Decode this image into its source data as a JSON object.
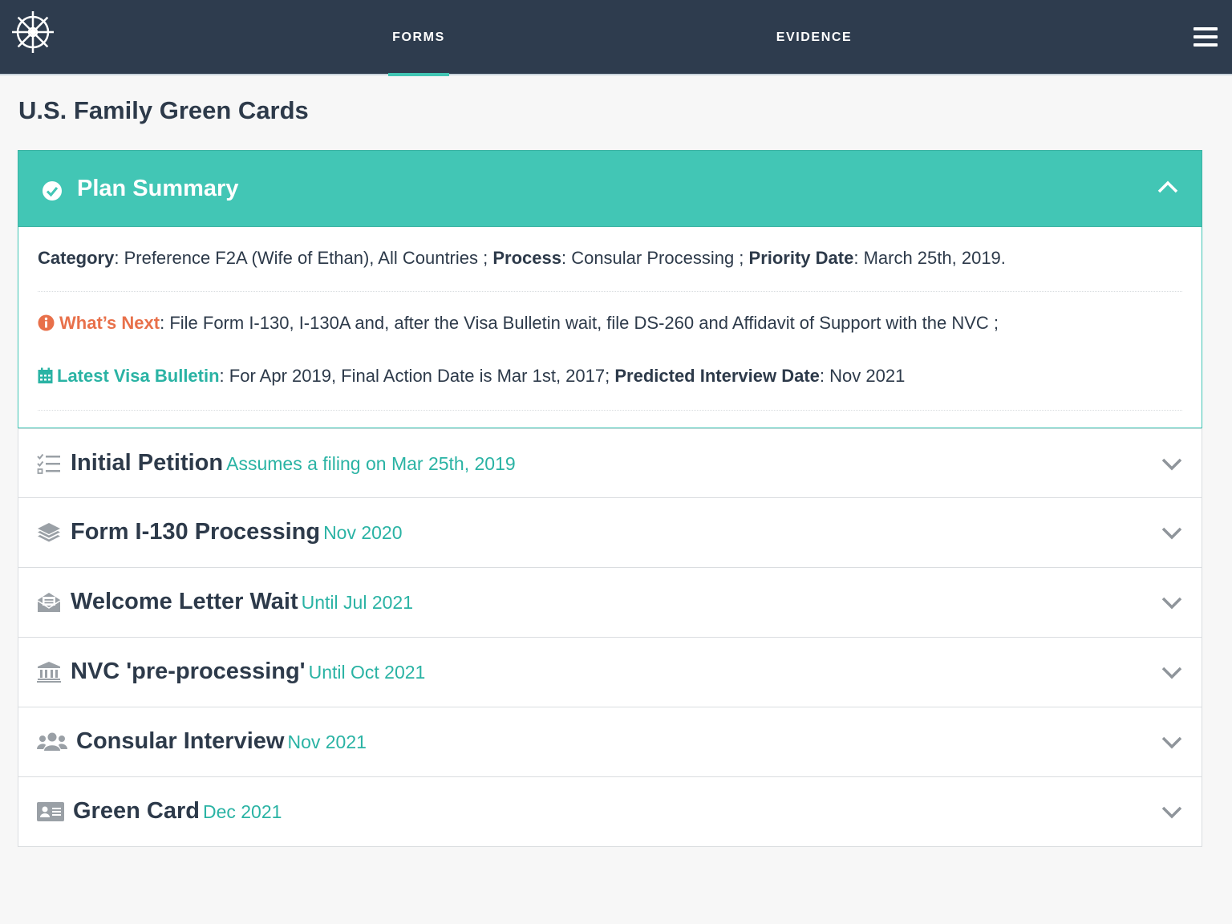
{
  "nav": {
    "logo_icon": "ship-wheel-icon",
    "tabs": [
      {
        "label": "FORMS",
        "active": true
      },
      {
        "label": "EVIDENCE",
        "active": false
      }
    ],
    "menu_icon": "hamburger-menu-icon"
  },
  "page": {
    "title": "U.S. Family Green Cards"
  },
  "summary": {
    "title": "Plan Summary",
    "category_label": "Category",
    "category_value": ": Preference F2A (Wife of Ethan), All Countries ; ",
    "process_label": "Process",
    "process_value": ": Consular Processing ; ",
    "priority_label": "Priority Date",
    "priority_value": ": March 25th, 2019.",
    "next_label": "What’s Next",
    "next_value": ": File Form I-130, I-130A and, after the Visa Bulletin wait, file DS-260 and Affidavit of Support with the NVC ;",
    "bulletin_label": "Latest Visa Bulletin",
    "bulletin_value": ": For Apr 2019, Final Action Date is Mar 1st, 2017; ",
    "interview_label": "Predicted Interview Date",
    "interview_value": ": Nov 2021"
  },
  "steps": [
    {
      "title": "Initial Petition",
      "subtitle": "Assumes a filing on Mar 25th, 2019",
      "icon": "checklist-icon"
    },
    {
      "title": "Form I-130 Processing",
      "subtitle": "Nov 2020",
      "icon": "layers-icon"
    },
    {
      "title": "Welcome Letter Wait",
      "subtitle": "Until Jul 2021",
      "icon": "envelope-open-icon"
    },
    {
      "title": "NVC 'pre-processing'",
      "subtitle": "Until Oct 2021",
      "icon": "bank-icon"
    },
    {
      "title": "Consular Interview",
      "subtitle": "Nov 2021",
      "icon": "users-icon"
    },
    {
      "title": "Green Card",
      "subtitle": "Dec 2021",
      "icon": "id-card-icon"
    }
  ],
  "colors": {
    "navbar": "#2e3c4e",
    "accent_teal": "#42c6b5",
    "subtitle_teal": "#2ab3a4",
    "warning_orange": "#e8704a",
    "text_dark": "#2d3a4a"
  }
}
